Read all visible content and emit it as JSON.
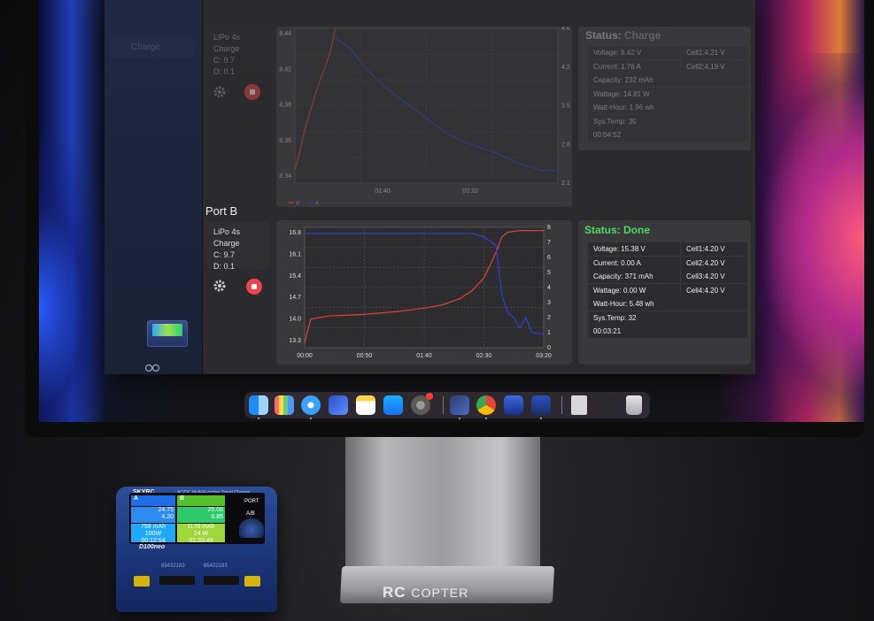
{
  "sidebar": {
    "items": [
      {
        "label": "Charge"
      }
    ]
  },
  "port_a": {
    "info": {
      "line1": "LiPo 4s",
      "line2": "Charge",
      "line3": "C: 9.7",
      "line4": "D: 0.1"
    },
    "status_label": "Status:",
    "status_value": "Charge",
    "stats_left": [
      "Voltage: 8.42 V",
      "Current: 1.76 A",
      "Capacity: 232 mAh",
      "Wattage: 14.81 W",
      "Watt-Hour: 1.96 wh",
      "Sys.Temp: 35",
      "00:04:52"
    ],
    "stats_right": [
      "Cell1:4.21 V",
      "Cell2:4.19 V"
    ]
  },
  "port_b": {
    "title": "Port B",
    "info": {
      "line1": "LiPo 4s",
      "line2": "Charge",
      "line3": "C: 9.7",
      "line4": "D: 0.1"
    },
    "status_label": "Status:",
    "status_value": "Done",
    "stats_left": [
      "Voltage: 15.38 V",
      "Current: 0.00 A",
      "Capacity: 371 mAh",
      "Wattage: 0.00 W",
      "Watt-Hour: 5.48 wh",
      "Sys.Temp: 32",
      "00:03:21"
    ],
    "stats_right": [
      "Cell1:4.20 V",
      "Cell2:4.20 V",
      "Cell3:4.20 V",
      "Cell4:4.20 V"
    ]
  },
  "chart_data": [
    {
      "type": "line",
      "title": "",
      "x_ticks": [
        "01:40",
        "03:20"
      ],
      "y_left_ticks": [
        "8.34",
        "8.36",
        "8.38",
        "8.42",
        "8.44"
      ],
      "y_right_ticks": [
        "2.1",
        "2.8",
        "3.5",
        "4.2",
        "4.6"
      ],
      "legend": [
        "V",
        "A"
      ],
      "colors": {
        "V": "#e0433a",
        "A": "#2b3fd6"
      },
      "x_range_s": [
        0,
        260
      ],
      "y_left_range": [
        8.33,
        8.45
      ],
      "y_right_range": [
        1.6,
        4.7
      ],
      "series": [
        {
          "name": "V",
          "axis": "left",
          "x": [
            0,
            5,
            10,
            15,
            20,
            25,
            30,
            35,
            40
          ],
          "y": [
            8.34,
            8.355,
            8.372,
            8.385,
            8.398,
            8.41,
            8.42,
            8.432,
            8.45
          ]
        },
        {
          "name": "A",
          "axis": "right",
          "x": [
            40,
            55,
            70,
            90,
            110,
            130,
            150,
            170,
            200,
            220,
            245,
            260
          ],
          "y": [
            4.5,
            4.3,
            3.9,
            3.5,
            3.2,
            2.9,
            2.6,
            2.4,
            2.2,
            2.0,
            1.85,
            1.85
          ]
        }
      ]
    },
    {
      "type": "line",
      "title": "",
      "x_ticks": [
        "00:00",
        "00:50",
        "01:40",
        "02:30",
        "03:20"
      ],
      "y_left_ticks": [
        "13.3",
        "14.0",
        "14.7",
        "15.4",
        "16.1",
        "16.8"
      ],
      "y_right_ticks": [
        "0",
        "1",
        "2",
        "3",
        "4",
        "5",
        "6",
        "7",
        "8"
      ],
      "legend": [
        "V",
        "A"
      ],
      "colors": {
        "V": "#e0433a",
        "A": "#2b3fd6"
      },
      "x_range_s": [
        0,
        200
      ],
      "y_left_range": [
        13.2,
        17.0
      ],
      "y_right_range": [
        0,
        8
      ],
      "series": [
        {
          "name": "V",
          "axis": "left",
          "x": [
            0,
            5,
            20,
            50,
            80,
            100,
            115,
            130,
            140,
            150,
            160,
            165,
            170,
            180,
            200
          ],
          "y": [
            13.35,
            14.1,
            14.2,
            14.25,
            14.35,
            14.45,
            14.55,
            14.75,
            15.0,
            15.4,
            16.2,
            16.7,
            16.85,
            16.9,
            16.9
          ]
        },
        {
          "name": "A",
          "axis": "right",
          "x": [
            0,
            5,
            60,
            110,
            140,
            150,
            155,
            160,
            165,
            170,
            175,
            180,
            185,
            190,
            200
          ],
          "y": [
            7.6,
            7.6,
            7.6,
            7.6,
            7.6,
            7.35,
            7.1,
            6.8,
            3.5,
            2.3,
            2.0,
            1.3,
            2.0,
            1.0,
            0.9
          ]
        }
      ]
    }
  ],
  "charger": {
    "brand": "SKYRC",
    "subtitle": "AC/DC Multi-Function Smart Charger",
    "model": "D100neo",
    "port_word": "PORT",
    "ab": "A/B",
    "a": {
      "label": "A",
      "v": "24.75",
      "i": "4.20",
      "cap": "759 mAh",
      "w": "100W",
      "t": "00:12:54"
    },
    "b": {
      "label": "B",
      "v": "25.08",
      "i": "0.85",
      "cap": "1170 mAh",
      "w": "24 W",
      "t": "01:33:48"
    },
    "sensor_labels": [
      "65432183",
      "65432183"
    ]
  },
  "watermark": {
    "rc": "RC",
    "copter": "COPTER"
  },
  "colors": {
    "accent_green": "#4cd964",
    "stop_red": "#f1444a",
    "voltage": "#e0433a",
    "current": "#2b3fd6"
  }
}
